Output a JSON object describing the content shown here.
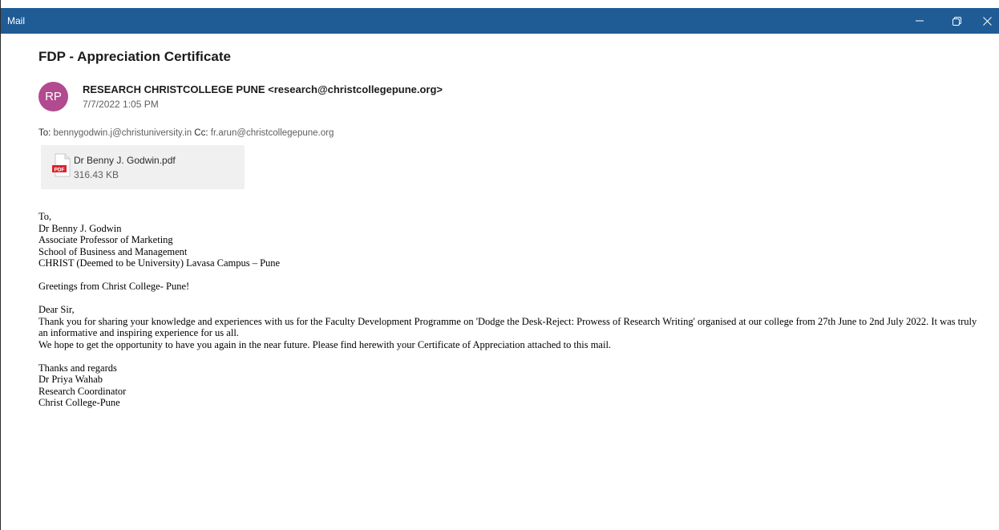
{
  "window": {
    "app_title": "Mail"
  },
  "message": {
    "subject": "FDP - Appreciation Certificate",
    "avatar_initials": "RP",
    "avatar_color": "#b14a8f",
    "sender_name": "RESEARCH CHRISTCOLLEGE PUNE",
    "sender_email": "<research@christcollegepune.org>",
    "date": "7/7/2022 1:05 PM",
    "to_label": "To:",
    "to": "bennygodwin.j@christuniversity.in",
    "cc_label": "Cc:",
    "cc": "fr.arun@christcollegepune.org"
  },
  "attachment": {
    "icon_label": "PDF",
    "file_name": "Dr Benny J. Godwin.pdf",
    "file_size": "316.43 KB"
  },
  "body": {
    "address": [
      "To,",
      "Dr Benny J. Godwin",
      "Associate Professor of Marketing",
      "School of Business and Management",
      "CHRIST (Deemed to be University) Lavasa Campus – Pune"
    ],
    "greeting": "Greetings from Christ College- Pune!",
    "salutation": "Dear Sir,",
    "paragraph1": "Thank you for sharing your knowledge and  experiences with us for the Faculty Development Programme on 'Dodge the Desk-Reject: Prowess of Research Writing' organised at our college from 27th June to 2nd July 2022. It was truly an informative and inspiring experience for us all.",
    "paragraph2": "We hope to get the opportunity to have you again in the near future. Please find herewith your Certificate of Appreciation attached to this mail.",
    "signature": [
      "Thanks and regards",
      "Dr Priya Wahab",
      "Research Coordinator",
      "Christ College-Pune"
    ]
  },
  "colors": {
    "titlebar": "#1f5c96",
    "pdf_red": "#d9232e"
  }
}
